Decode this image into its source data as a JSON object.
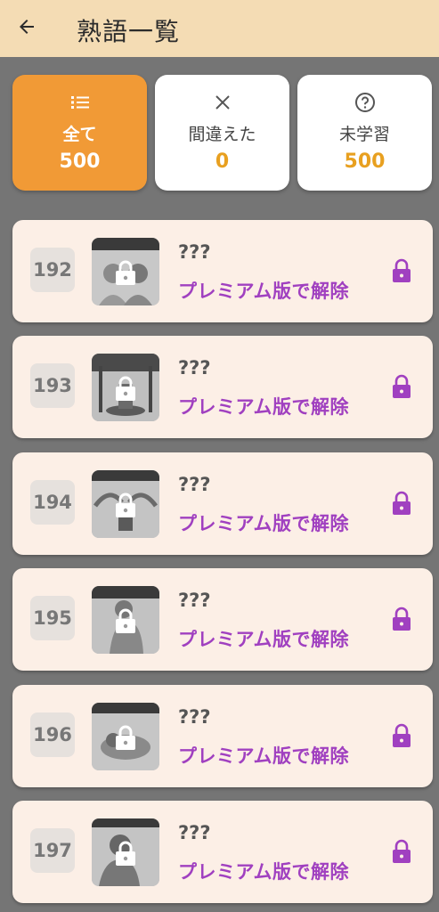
{
  "header": {
    "title": "熟語一覧",
    "back_icon": "arrow-left-icon"
  },
  "colors": {
    "header_bg": "#f4dcb4",
    "accent": "#f19a36",
    "premium": "#a040c0",
    "count": "#e8a020"
  },
  "filters": [
    {
      "icon": "list-icon",
      "label": "全て",
      "count": "500",
      "active": true
    },
    {
      "icon": "close-icon",
      "label": "間違えた",
      "count": "0",
      "active": false
    },
    {
      "icon": "help-circle-icon",
      "label": "未学習",
      "count": "500",
      "active": false
    }
  ],
  "cards": [
    {
      "number": "192",
      "word": "???",
      "premium_text": "プレミアム版で解除"
    },
    {
      "number": "193",
      "word": "???",
      "premium_text": "プレミアム版で解除"
    },
    {
      "number": "194",
      "word": "???",
      "premium_text": "プレミアム版で解除"
    },
    {
      "number": "195",
      "word": "???",
      "premium_text": "プレミアム版で解除"
    },
    {
      "number": "196",
      "word": "???",
      "premium_text": "プレミアム版で解除"
    },
    {
      "number": "197",
      "word": "???",
      "premium_text": "プレミアム版で解除"
    }
  ]
}
